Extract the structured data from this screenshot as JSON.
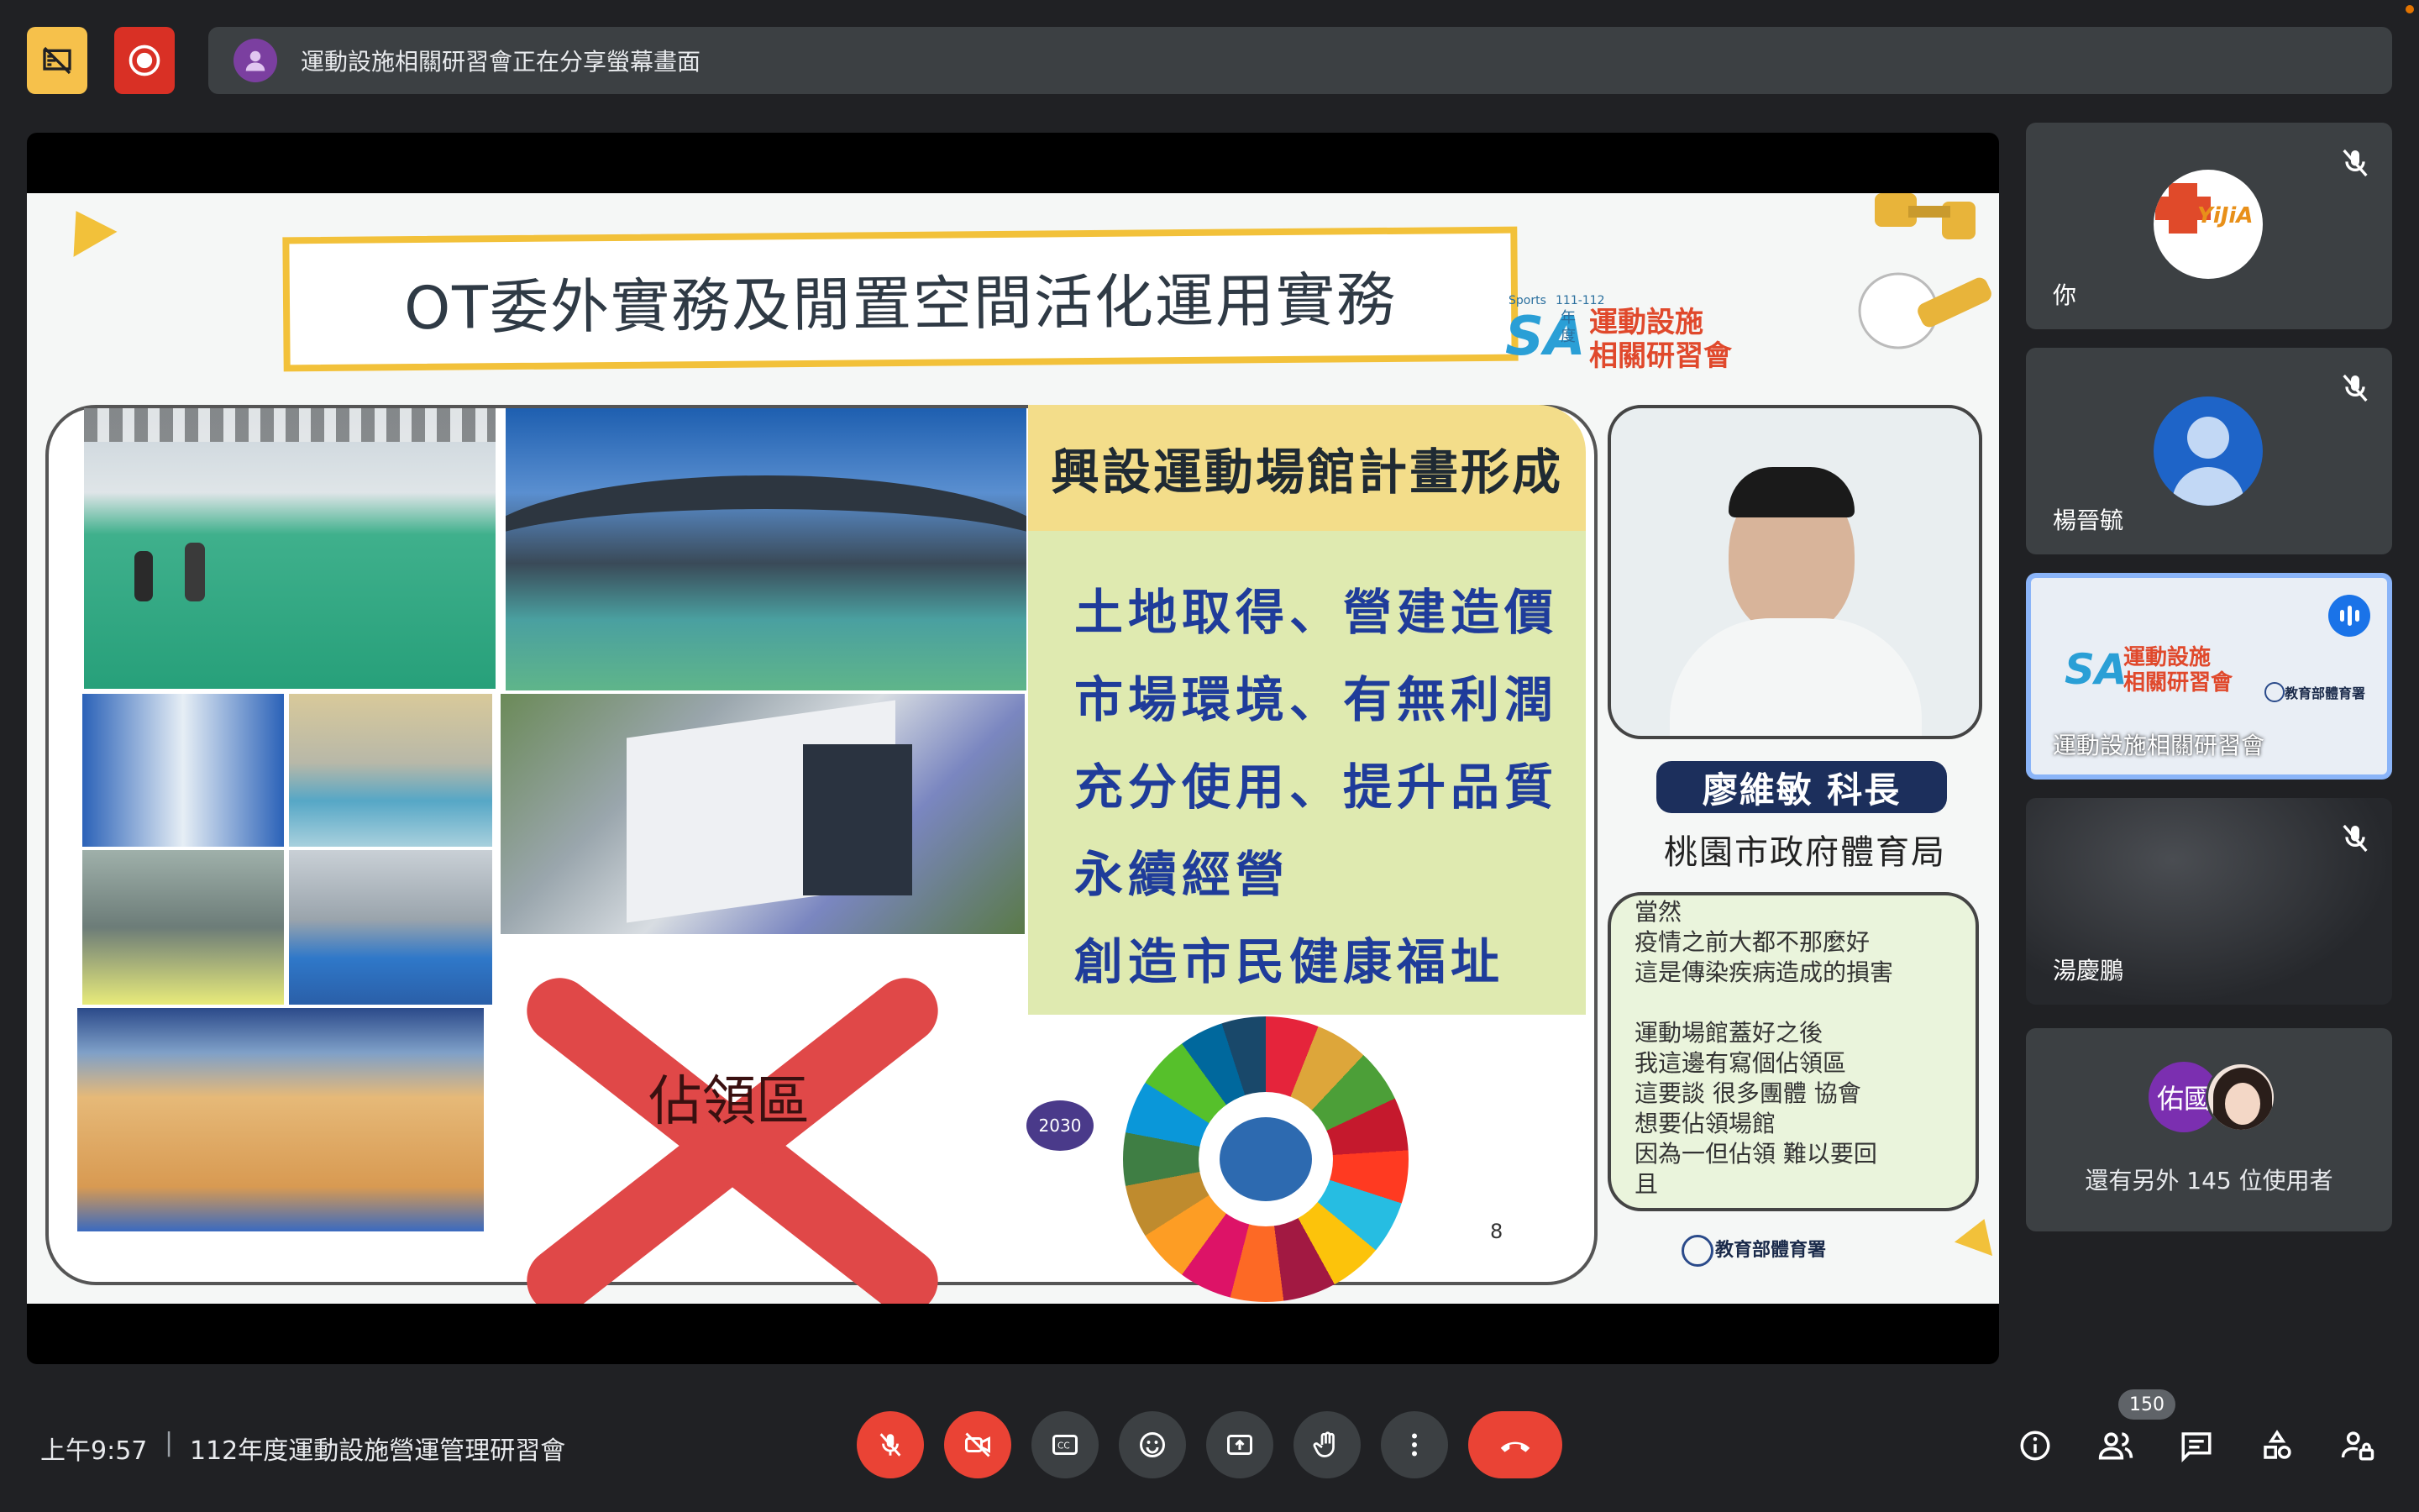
{
  "banner": {
    "text": "運動設施相關研習會正在分享螢幕畫面"
  },
  "slide": {
    "title": "OT委外實務及閒置空間活化運用實務",
    "logo": {
      "years": "111-112",
      "nian": "年度",
      "sa": "SA",
      "small": "Sports",
      "name_line1": "運動設施",
      "name_line2": "相關研習會"
    },
    "plan_heading": "興設運動場館計畫形成",
    "plan_items": [
      "土地取得、營建造價",
      "市場環境、有無利潤",
      "充分使用、提升品質",
      "永續經營",
      "創造市民健康福址"
    ],
    "redx_label": "佔領區",
    "page_number": "8",
    "speaker_name": "廖維敏 科長",
    "speaker_org": "桃園市政府體育局",
    "caption_lines": [
      "當然",
      "疫情之前大都不那麼好",
      "這是傳染疾病造成的損害",
      "",
      "運動場館蓋好之後",
      "我這邊有寫個佔領區",
      "這要談 很多團體 協會",
      "想要佔領場館",
      "因為一但佔領 難以要回",
      "且"
    ],
    "moe_logo": "教育部體育署",
    "sdg_label": "2030"
  },
  "participants": [
    {
      "name": "你",
      "avatar_text": "YiJiA",
      "muted": true
    },
    {
      "name": "楊晉毓",
      "muted": true
    },
    {
      "name": "運動設施相關研習會",
      "speaking": true,
      "logo_name": "運動設施相關研習會"
    },
    {
      "name": "湯慶鵬",
      "muted": true
    }
  ],
  "others": {
    "avatar_text": "佑國",
    "text": "還有另外 145 位使用者"
  },
  "bottom": {
    "time": "上午9:57",
    "separator": "|",
    "meeting_title": "112年度運動設施營運管理研習會",
    "people_count": "150"
  },
  "colors": {
    "bg": "#202124",
    "tile": "#3c4043",
    "red": "#ea4335",
    "accent_blue": "#8ab4f8",
    "warn_yellow": "#f6c14b"
  }
}
